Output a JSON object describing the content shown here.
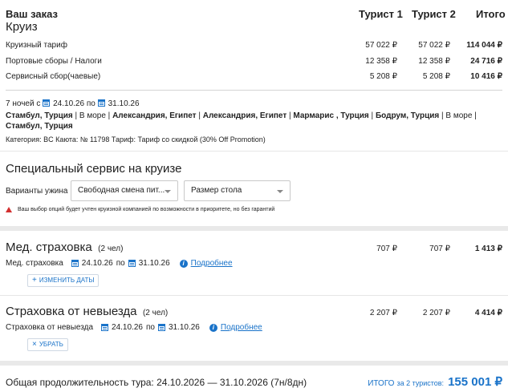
{
  "order": {
    "title": "Ваш заказ",
    "subtitle": "Круиз",
    "col_tourist1": "Турист 1",
    "col_tourist2": "Турист 2",
    "col_total": "Итого",
    "rows": [
      {
        "label": "Круизный тариф",
        "t1": "57 022 ₽",
        "t2": "57 022 ₽",
        "total": "114 044 ₽"
      },
      {
        "label": "Портовые сборы / Налоги",
        "t1": "12 358 ₽",
        "t2": "12 358 ₽",
        "total": "24 716 ₽"
      },
      {
        "label": "Сервисный сбор(чаевые)",
        "t1": "5 208 ₽",
        "t2": "5 208 ₽",
        "total": "10 416 ₽"
      }
    ],
    "nights": "7 ночей с",
    "date_from": "24.10.26",
    "by": "по",
    "date_to": "31.10.26",
    "route_line1_parts": [
      "Стамбул, Турция",
      " | В море | ",
      "Александрия, Египет",
      " | ",
      "Александрия, Египет",
      " | ",
      "Мармарис , Турция",
      " | ",
      "Бодрум, Турция",
      " | В море |"
    ],
    "route_line2": "Стамбул, Турция",
    "details": "Категория: BC   Каюта: № 11798   Тариф: Тариф со скидкой (30% Off Promotion)"
  },
  "service": {
    "title": "Специальный сервис на круизе",
    "dinner_label": "Варианты ужина",
    "dinner_value": "Свободная смена пит...",
    "table_value": "Размер стола",
    "warning": "Ваш выбор опций будет учтен круизной компанией по возможности в приоритете, но без гарантий"
  },
  "med": {
    "title": "Мед. страховка",
    "count": "(2 чел)",
    "t1": "707 ₽",
    "t2": "707 ₽",
    "total": "1 413 ₽",
    "line_label": "Мед. страховка",
    "date_from": "24.10.26",
    "by": "по",
    "date_to": "31.10.26",
    "more": "Подробнее",
    "button": "ИЗМЕНИТЬ ДАТЫ"
  },
  "cancel": {
    "title": "Страховка от невыезда",
    "count": "(2 чел)",
    "t1": "2 207 ₽",
    "t2": "2 207 ₽",
    "total": "4 414 ₽",
    "line_label": "Страховка от невыезда",
    "date_from": "24.10.26",
    "by": "по",
    "date_to": "31.10.26",
    "more": "Подробнее",
    "button": "УБРАТЬ"
  },
  "footer": {
    "duration": "Общая продолжительность тура: 24.10.2026 — 31.10.2026 (7н/8дн)",
    "total_label": "ИТОГО",
    "total_for": "за 2 туристов:",
    "total_value": "155 001 ₽"
  },
  "colors": {
    "accent": "#1a73c9",
    "warning": "#d32f2f"
  }
}
